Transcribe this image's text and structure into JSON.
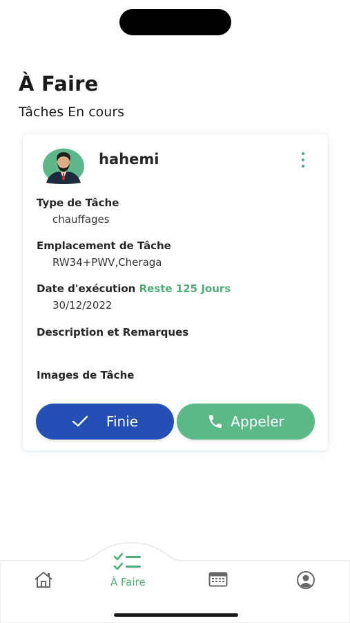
{
  "page": {
    "title": "À Faire",
    "section_title": "Tâches En cours"
  },
  "task": {
    "user_name": "hahemi",
    "type_label": "Type de Tâche",
    "type_value": "chauffages",
    "location_label": "Emplacement de Tâche",
    "location_value": "RW34+PWV,Cheraga",
    "date_label": "Date d'exécution",
    "remaining": "Reste 125 Jours",
    "date_value": "30/12/2022",
    "description_label": "Description et Remarques",
    "images_label": "Images de Tâche"
  },
  "actions": {
    "done_label": "Finie",
    "call_label": "Appeler"
  },
  "nav": {
    "items": [
      {
        "icon": "home-icon",
        "label": ""
      },
      {
        "icon": "checklist-icon",
        "label": "À Faire",
        "active": true
      },
      {
        "icon": "calendar-icon",
        "label": ""
      },
      {
        "icon": "profile-icon",
        "label": ""
      }
    ]
  },
  "colors": {
    "accent_green": "#4caf75",
    "done_blue": "#2450b6",
    "call_green": "#5bb987"
  }
}
